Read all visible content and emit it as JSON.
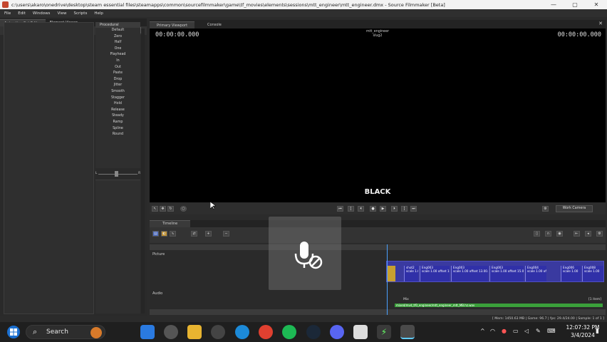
{
  "window": {
    "title": "c:\\users\\akaro\\onedrive\\desktop\\steam essential files\\steamapps\\common\\sourcefilmmaker\\game\\tf_movies\\elements\\sessions\\mtt_engineer\\mtt_engineer.dmx - Source Filmmaker [Beta]",
    "minimize": "—",
    "maximize": "▢",
    "close": "✕"
  },
  "menu": [
    "File",
    "Edit",
    "Windows",
    "View",
    "Scripts",
    "Help"
  ],
  "left_panel": {
    "tabs": [
      "Animation Set Editor",
      "Element Viewer"
    ],
    "add_button": "+",
    "procedural_header": "Procedural",
    "procedural_items": [
      "Default",
      "Zero",
      "Half",
      "One",
      "Playhead",
      "In",
      "Out",
      "Paste",
      "Drop",
      "Jitter",
      "Smooth",
      "Stagger",
      "Hold",
      "Release",
      "Steady",
      "Ramp",
      "Spline",
      "Round"
    ],
    "slider_left": "L",
    "slider_right": "R"
  },
  "viewport": {
    "tabs": [
      "Primary Viewport",
      "Console"
    ],
    "timecode_left": "00:00:00.000",
    "timecode_right": "00:00:00.000",
    "shot_name": "mtt_engineer",
    "shot_sub": "slug2",
    "black_label": "BLACK",
    "camera_button": "Work Camera"
  },
  "timeline": {
    "tab": "Timeline",
    "track_picture": "Picture",
    "track_audio": "Audio",
    "mix_label": "Mix",
    "mix_right": "[1 item]",
    "clips": [
      {
        "name": "shot2",
        "sub": "scale 1.00"
      },
      {
        "name": "Eng003",
        "sub": "scale 1.00 offset 10.00..."
      },
      {
        "name": "Eng003",
        "sub": "scale 1.00 offset 13.00..."
      },
      {
        "name": "Eng003",
        "sub": "scale 1.00 offset 15.0..."
      },
      {
        "name": "Eng004",
        "sub": "scale 1.00 offset"
      },
      {
        "name": "Eng006",
        "sub": "scale 1.00"
      },
      {
        "name": "Eng008",
        "sub": "scale 1.00"
      }
    ],
    "audio_clip": "mixed/mvd_tf0_engineer/mtt_engineer_mtt_MB.hz.wav"
  },
  "status_bar": "[ Mem: 1450.63 MB | Game:   96.7 | fps:   29.4/24.00 | Sample:   1 of 1 ]",
  "taskbar": {
    "search": "Search",
    "time": "12:07:32 PM",
    "date": "3/4/2024"
  },
  "colors": {
    "shot_strip": "#3a3aa0",
    "audio_clip": "#3aa03a",
    "playhead": "#4aa0ff"
  }
}
